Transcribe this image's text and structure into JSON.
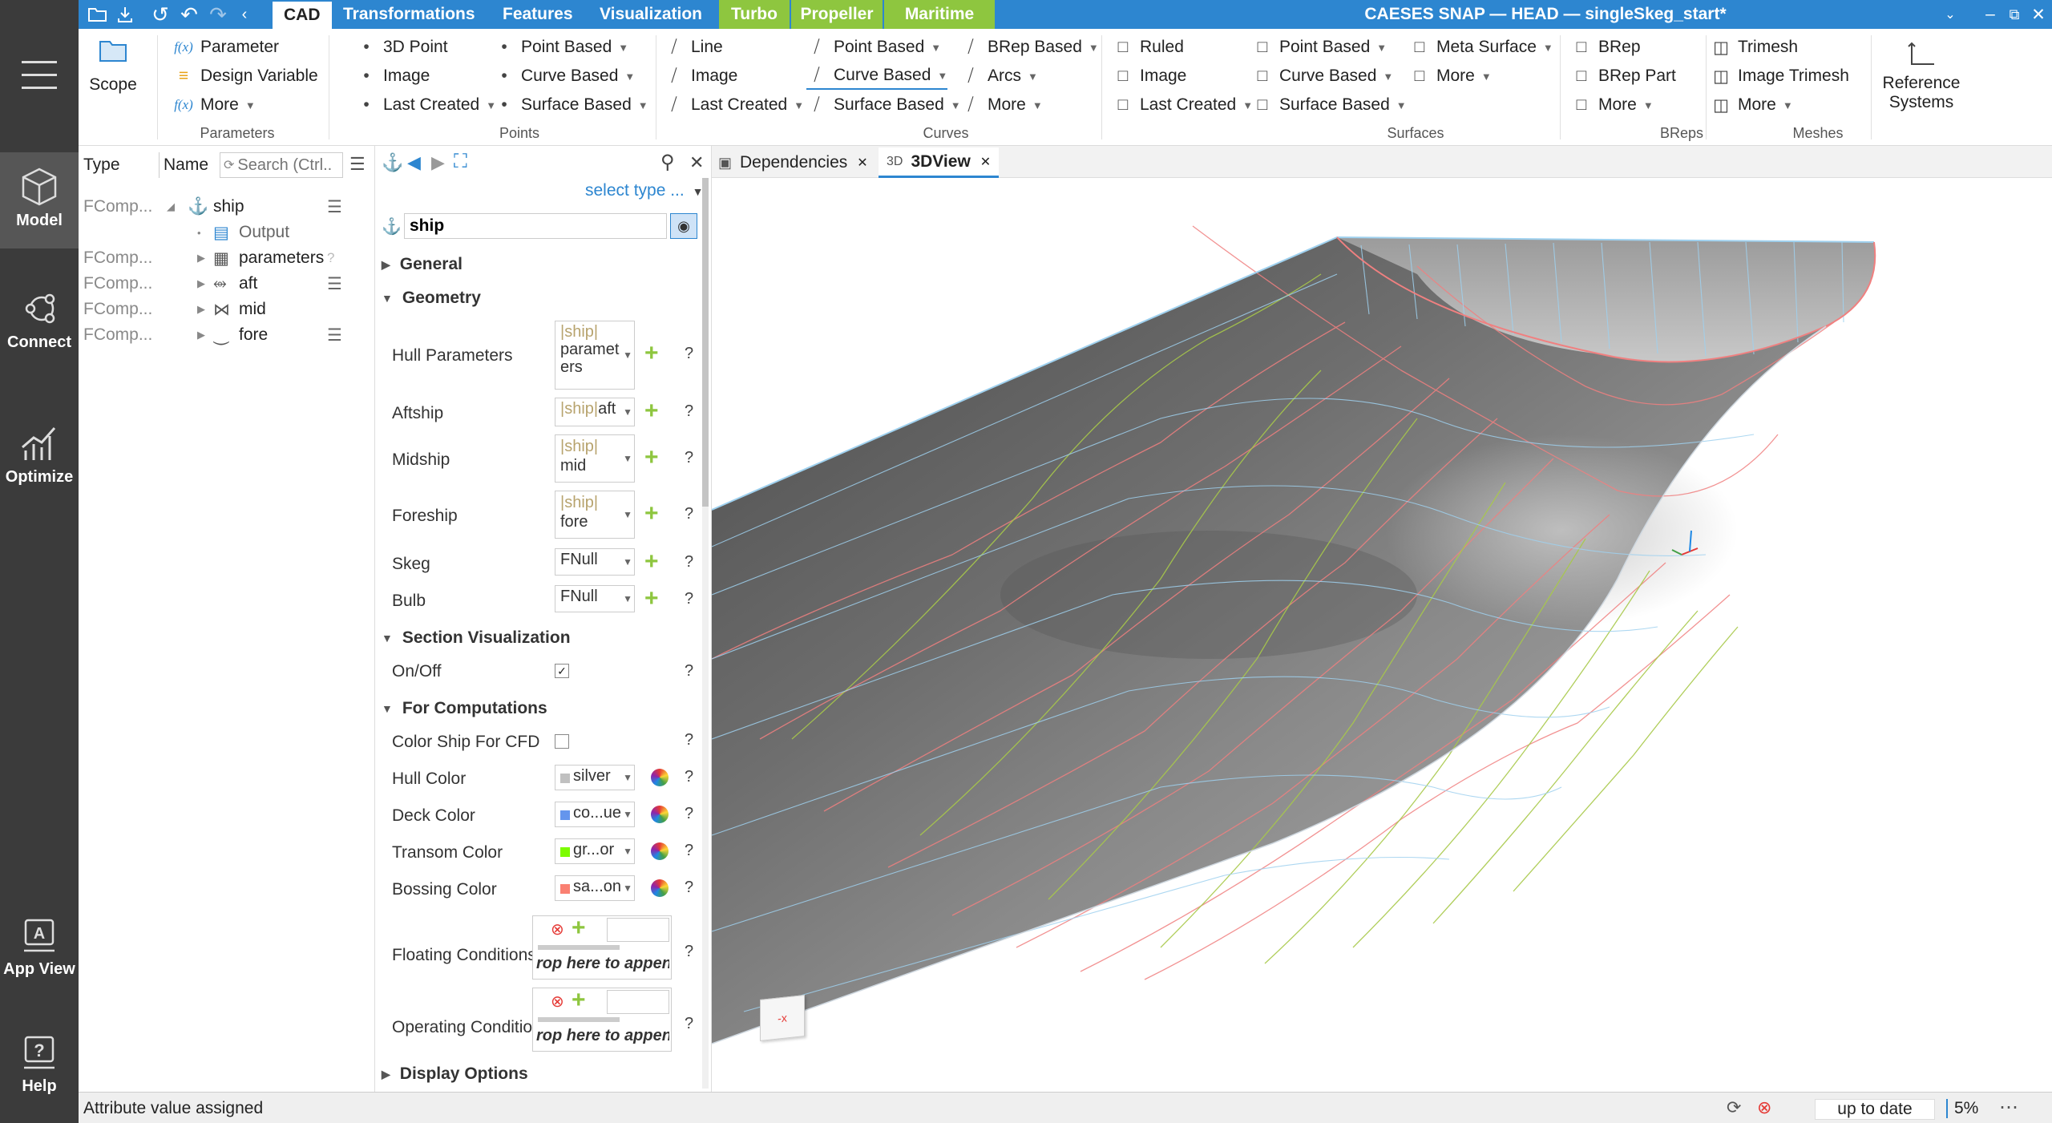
{
  "window": {
    "title": "CAESES SNAP — HEAD — singleSkeg_start*"
  },
  "menu_tabs": [
    {
      "label": "CAD",
      "active": true
    },
    {
      "label": "Transformations"
    },
    {
      "label": "Features"
    },
    {
      "label": "Visualization"
    },
    {
      "label": "Turbo",
      "accent": "#8ec63f"
    },
    {
      "label": "Propeller",
      "accent": "#8ec63f"
    },
    {
      "label": "Maritime",
      "accent": "#8ec63f"
    }
  ],
  "left_nav": [
    {
      "label": "Model",
      "icon": "cube-icon",
      "active": true
    },
    {
      "label": "Connect",
      "icon": "connect-icon"
    },
    {
      "label": "Optimize",
      "icon": "chart-icon"
    },
    {
      "label": "App View",
      "icon": "appview-icon"
    },
    {
      "label": "Help",
      "icon": "help-icon"
    }
  ],
  "ribbon": {
    "scope": "Scope",
    "parameters": {
      "items": [
        "Parameter",
        "Design Variable",
        "More"
      ],
      "label": "Parameters"
    },
    "points": {
      "col1": [
        "3D Point",
        "Image",
        "Last Created"
      ],
      "col2": [
        "Point Based",
        "Curve Based",
        "Surface Based"
      ],
      "label": "Points"
    },
    "curves": {
      "col1": [
        "Line",
        "Image",
        "Last Created"
      ],
      "col2": [
        "Point Based",
        "Curve Based",
        "Surface Based"
      ],
      "col3": [
        "BRep Based",
        "Arcs",
        "More"
      ],
      "label": "Curves"
    },
    "surfaces": {
      "col1": [
        "Ruled",
        "Image",
        "Last Created"
      ],
      "col2": [
        "Point Based",
        "Curve Based",
        "Surface Based"
      ],
      "col3": [
        "Meta Surface",
        "More"
      ],
      "label": "Surfaces"
    },
    "breps": {
      "items": [
        "BRep",
        "BRep Part",
        "More"
      ],
      "label": "BReps"
    },
    "meshes": {
      "items": [
        "Trimesh",
        "Image Trimesh",
        "More"
      ],
      "label": "Meshes"
    },
    "reference_systems": {
      "line1": "Reference",
      "line2": "Systems"
    }
  },
  "tree": {
    "col_type": "Type",
    "col_name": "Name",
    "search_placeholder": "Search (Ctrl...",
    "rows": [
      {
        "type": "FComp...",
        "name": "ship",
        "expanded": true
      },
      {
        "type": "",
        "name": "Output"
      },
      {
        "type": "FComp...",
        "name": "parameters"
      },
      {
        "type": "FComp...",
        "name": "aft"
      },
      {
        "type": "FComp...",
        "name": "mid"
      },
      {
        "type": "FComp...",
        "name": "fore"
      }
    ]
  },
  "props": {
    "select_type": "select type ...",
    "object_name": "ship",
    "sections": {
      "general": "General",
      "geometry": "Geometry",
      "section_vis": "Section Visualization",
      "for_comp": "For Computations",
      "display": "Display Options"
    },
    "fields": {
      "hull_params": {
        "label": "Hull Parameters",
        "prefix": "|ship|",
        "value": "parameters"
      },
      "aftship": {
        "label": "Aftship",
        "prefix": "|ship|",
        "value": "aft"
      },
      "midship": {
        "label": "Midship",
        "prefix": "|ship|",
        "value": "mid"
      },
      "foreship": {
        "label": "Foreship",
        "prefix": "|ship|",
        "value": "fore"
      },
      "skeg": {
        "label": "Skeg",
        "value": "FNull"
      },
      "bulb": {
        "label": "Bulb",
        "value": "FNull"
      },
      "onoff": {
        "label": "On/Off",
        "checked": true
      },
      "color_cfd": {
        "label": "Color Ship For CFD",
        "checked": false
      },
      "hull_color": {
        "label": "Hull Color",
        "value": "silver",
        "swatch": "#c0c0c0"
      },
      "deck_color": {
        "label": "Deck Color",
        "value": "co...ue",
        "swatch": "#6495ed"
      },
      "transom_color": {
        "label": "Transom Color",
        "value": "gr...or",
        "swatch": "#7cfc00"
      },
      "bossing_color": {
        "label": "Bossing Color",
        "value": "sa...on",
        "swatch": "#fa8072"
      },
      "floating": {
        "label": "Floating Conditions",
        "drop": "rop here to appen"
      },
      "operating": {
        "label": "Operating Conditions",
        "drop": "rop here to appen"
      }
    }
  },
  "view_tabs": [
    {
      "label": "Dependencies"
    },
    {
      "label": "3DView",
      "active": true
    }
  ],
  "status": {
    "message": "Attribute value assigned",
    "state": "up to date",
    "progress": "5%"
  }
}
